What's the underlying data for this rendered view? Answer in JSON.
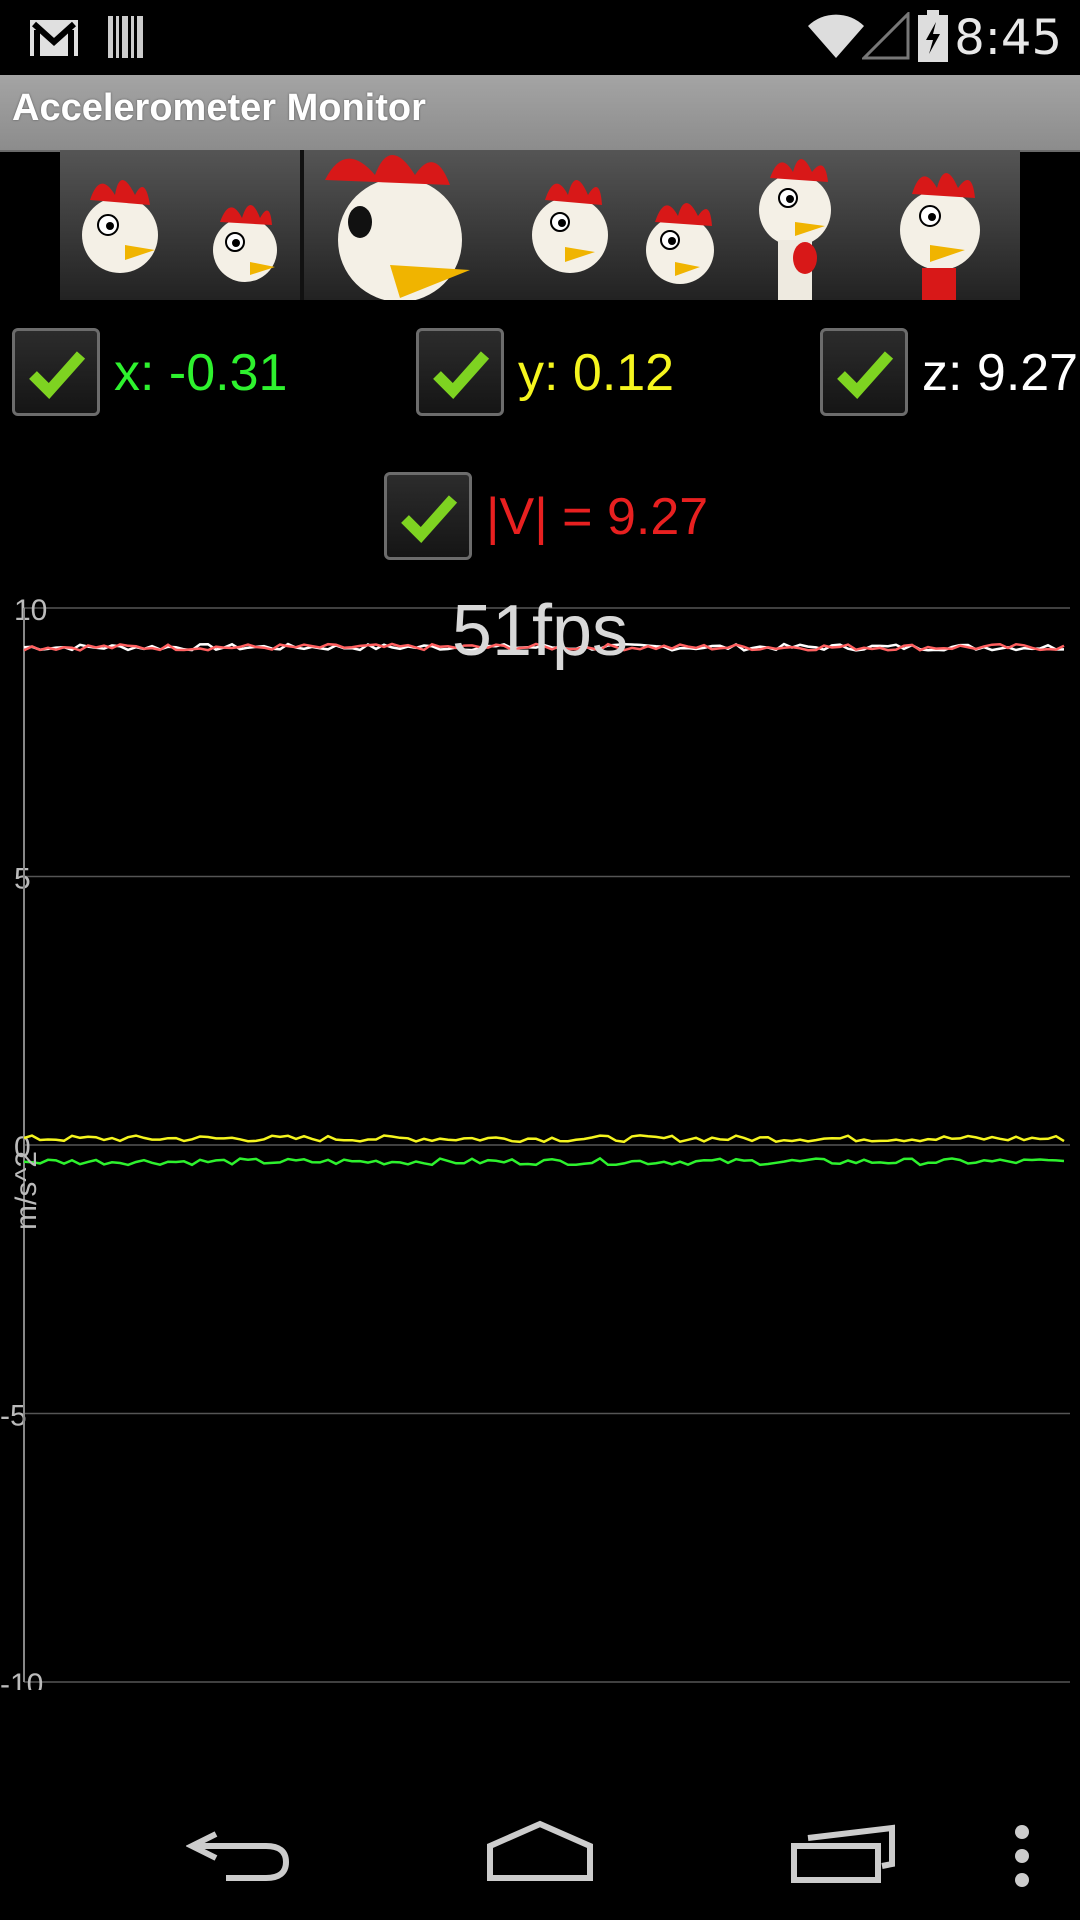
{
  "status_bar": {
    "time": "8:45",
    "icons": [
      "gmail-icon",
      "barcode-icon",
      "wifi-icon",
      "signal-icon",
      "battery-charging-icon"
    ]
  },
  "app": {
    "title": "Accelerometer Monitor"
  },
  "banner": {
    "description_icon": "chickens-ad-banner"
  },
  "readings": {
    "x": {
      "label": "x: -0.31",
      "checked": true,
      "color": "#2ef22e"
    },
    "y": {
      "label": "y: 0.12",
      "checked": true,
      "color": "#f5f51e"
    },
    "z": {
      "label": "z: 9.27",
      "checked": true,
      "color": "#ffffff"
    },
    "v": {
      "label": "|V| = 9.27",
      "checked": true,
      "color": "#e82020"
    }
  },
  "fps": "51fps",
  "chart_data": {
    "type": "line",
    "ylabel": "m/s^2",
    "ylim": [
      -10,
      10
    ],
    "yticks": [
      "10",
      "5",
      "0",
      "-5",
      "-10"
    ],
    "grid": true,
    "series": [
      {
        "name": "z",
        "color": "#ffffff",
        "level": 9.27
      },
      {
        "name": "|V|",
        "color": "#ff6060",
        "level": 9.27
      },
      {
        "name": "y",
        "color": "#f5f51e",
        "level": 0.12
      },
      {
        "name": "x",
        "color": "#2ef22e",
        "level": -0.31
      }
    ]
  },
  "nav": {
    "back": "back-icon",
    "home": "home-icon",
    "recents": "recent-apps-icon",
    "menu": "overflow-menu-icon"
  }
}
